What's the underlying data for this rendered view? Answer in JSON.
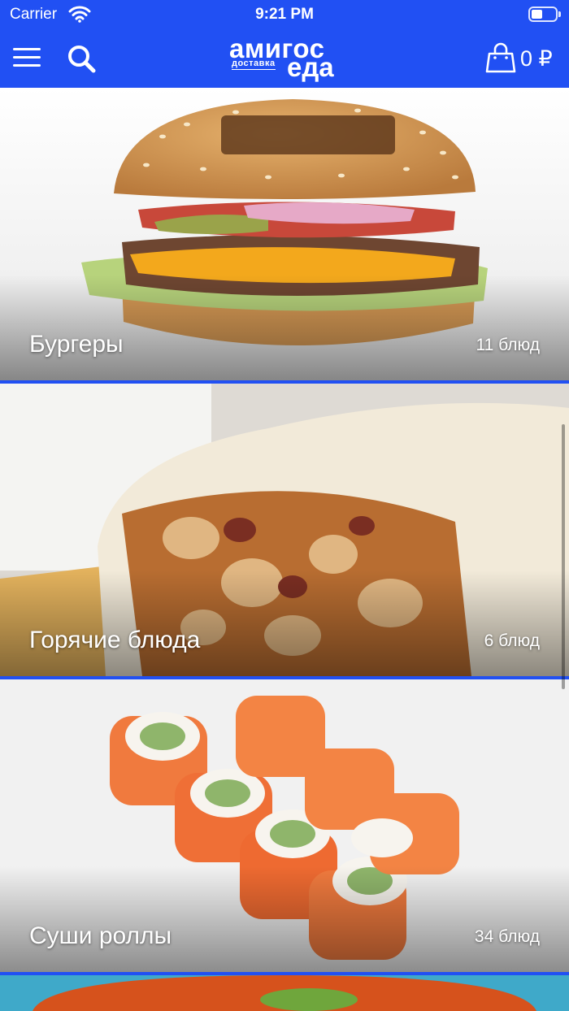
{
  "status_bar": {
    "carrier": "Carrier",
    "time": "9:21 PM"
  },
  "header": {
    "logo": {
      "top": "амигос",
      "small": "доставка",
      "big": "еда"
    },
    "icons": {
      "menu": "hamburger-menu-icon",
      "search": "search-icon",
      "cart": "shopping-bag-icon"
    },
    "cart_total": "0 ₽"
  },
  "colors": {
    "brand": "#2150f3",
    "text_on_brand": "#ffffff"
  },
  "categories": [
    {
      "title": "Бургеры",
      "count": "11 блюд"
    },
    {
      "title": "Горячие блюда",
      "count": "6 блюд"
    },
    {
      "title": "Суши роллы",
      "count": "34 блюд"
    },
    {
      "title": "",
      "count": ""
    }
  ]
}
